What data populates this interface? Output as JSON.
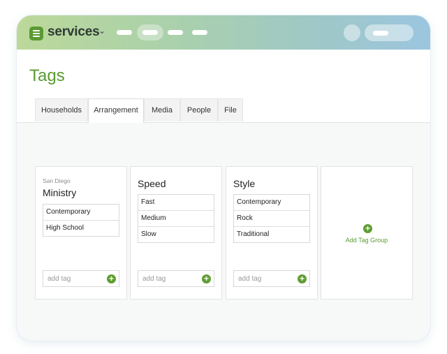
{
  "app": {
    "name": "services"
  },
  "page": {
    "title": "Tags"
  },
  "tabs": [
    {
      "label": "Households"
    },
    {
      "label": "Arrangement"
    },
    {
      "label": "Media"
    },
    {
      "label": "People"
    },
    {
      "label": "File"
    }
  ],
  "groups": [
    {
      "subtitle": "San Diego",
      "name": "Ministry",
      "tags": [
        "Contemporary",
        "High School"
      ],
      "add_placeholder": "add tag"
    },
    {
      "subtitle": "",
      "name": "Speed",
      "tags": [
        "Fast",
        "Medium",
        "Slow"
      ],
      "add_placeholder": "add tag"
    },
    {
      "subtitle": "",
      "name": "Style",
      "tags": [
        "Contemporary",
        "Rock",
        "Traditional"
      ],
      "add_placeholder": "add tag"
    }
  ],
  "add_group": {
    "label": "Add Tag Group"
  },
  "colors": {
    "accent": "#5a9a32"
  }
}
